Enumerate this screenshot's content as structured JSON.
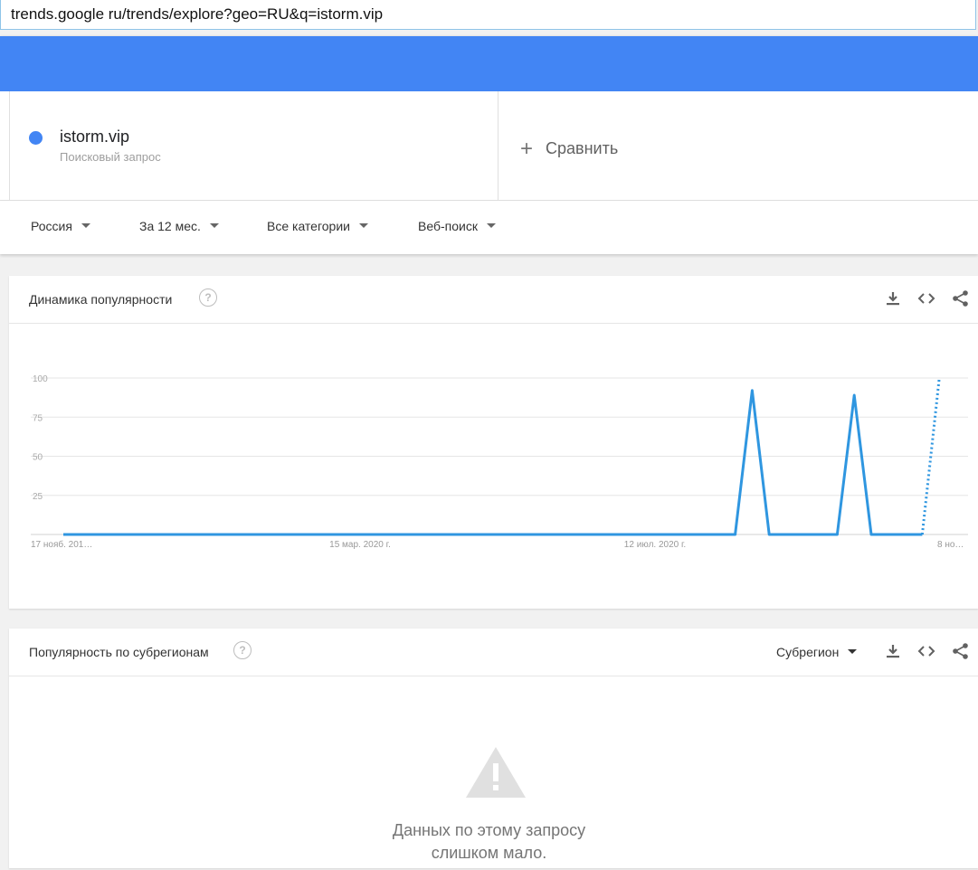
{
  "browser": {
    "url": "trends.google ru/trends/explore?geo=RU&q=istorm.vip"
  },
  "term": {
    "name": "istorm.vip",
    "type": "Поисковый запрос",
    "color": "#4285f4"
  },
  "compare": {
    "label": "Сравнить"
  },
  "filters": {
    "region": "Россия",
    "period": "За 12 мес.",
    "category": "Все категории",
    "search_type": "Веб-поиск"
  },
  "interest_over_time": {
    "title": "Динамика популярности",
    "icons": [
      "help-icon",
      "download-icon",
      "embed-icon",
      "share-icon"
    ]
  },
  "chart_data": {
    "type": "line",
    "title": "",
    "xlabel": "",
    "ylabel": "",
    "ylim": [
      0,
      100
    ],
    "yticks": [
      "100",
      "75",
      "50",
      "25"
    ],
    "xticks": [
      "17 нояб. 201…",
      "15 мар. 2020 г.",
      "12 июл. 2020 г.",
      "8 но…"
    ],
    "grid": true,
    "line_color": "#2f96e0",
    "series": [
      {
        "values": [
          0,
          0,
          0,
          0,
          0,
          0,
          0,
          0,
          0,
          0,
          0,
          0,
          0,
          0,
          0,
          0,
          0,
          0,
          0,
          0,
          0,
          0,
          0,
          0,
          0,
          0,
          0,
          0,
          0,
          0,
          0,
          0,
          0,
          0,
          0,
          0,
          0,
          0,
          0,
          0,
          0,
          0,
          0,
          0,
          0,
          0,
          0,
          0,
          0,
          0,
          0,
          0,
          0,
          0,
          0,
          0,
          0,
          0,
          0,
          0,
          0,
          0,
          0,
          0,
          0,
          0,
          0,
          0,
          0,
          0,
          0,
          0,
          0,
          0,
          0,
          0,
          0,
          0,
          0,
          0,
          0,
          0,
          0,
          0,
          0,
          0,
          0,
          0,
          0,
          0,
          0,
          0,
          0,
          0,
          0,
          0,
          0,
          0,
          0,
          0,
          0,
          0,
          0,
          0,
          0,
          0,
          0,
          0,
          0,
          0,
          0,
          0,
          0,
          0,
          0,
          0,
          0,
          0,
          0,
          0,
          0,
          0,
          0,
          0,
          0,
          0,
          0,
          0,
          0,
          0,
          0,
          0,
          0,
          0,
          0,
          0,
          0,
          0,
          0,
          0,
          0,
          0,
          0,
          0,
          0,
          0,
          0,
          0,
          0,
          0,
          0,
          0,
          0,
          0,
          0,
          0,
          0,
          0,
          0,
          0,
          0,
          0,
          0,
          0,
          0,
          0,
          0,
          0,
          0,
          0,
          0,
          0,
          0,
          0,
          0,
          0,
          0,
          0,
          0,
          0,
          0,
          0,
          0,
          0,
          0,
          0,
          0,
          0,
          0,
          0,
          0,
          0,
          0,
          0,
          0,
          0,
          0,
          0,
          0,
          0,
          0,
          0,
          0,
          0,
          0,
          0,
          0,
          0,
          0,
          0,
          0,
          0,
          0,
          0,
          0,
          0,
          0,
          0,
          0,
          0,
          0,
          0,
          0,
          0,
          0,
          0,
          0,
          0,
          0,
          0,
          0,
          0,
          0,
          0,
          0,
          0,
          0,
          0,
          0,
          0,
          0,
          0,
          0,
          0,
          0,
          0,
          0,
          0,
          0,
          0,
          0,
          0,
          0,
          0,
          0,
          0,
          0,
          0,
          0,
          0,
          0,
          0,
          0,
          0,
          0,
          0,
          0,
          0,
          0,
          0,
          0,
          0,
          0,
          0,
          0,
          0,
          0,
          0,
          0,
          0,
          0,
          0,
          0,
          0,
          0,
          0,
          0,
          0,
          0,
          0,
          0,
          0,
          0,
          0,
          0,
          0,
          0,
          0,
          0,
          0,
          0,
          0,
          0,
          0,
          0,
          0,
          0,
          0,
          0,
          0,
          0,
          0,
          0,
          0,
          0,
          0,
          0,
          0,
          0,
          0,
          0,
          0,
          0,
          0,
          0,
          0,
          0,
          0,
          0,
          0,
          0,
          0,
          0,
          0,
          0,
          0,
          0,
          0,
          0,
          0,
          0,
          0,
          0,
          0,
          0,
          0,
          0,
          0,
          0,
          0,
          0,
          0,
          0,
          0,
          0,
          0,
          0,
          0,
          0,
          0,
          0,
          0,
          0,
          0,
          0,
          0,
          0
        ]
      }
    ],
    "points": [
      {
        "t": 0.0,
        "v": 0
      },
      {
        "t": 0.79,
        "v": 0
      },
      {
        "t": 0.81,
        "v": 92
      },
      {
        "t": 0.83,
        "v": 0
      },
      {
        "t": 0.91,
        "v": 0
      },
      {
        "t": 0.93,
        "v": 89
      },
      {
        "t": 0.95,
        "v": 0
      },
      {
        "t": 1.01,
        "v": 0
      }
    ],
    "partial_points": [
      {
        "t": 1.01,
        "v": 0
      },
      {
        "t": 1.03,
        "v": 100
      }
    ]
  },
  "interest_by_region": {
    "title": "Популярность по субрегионам",
    "resolution": "Субрегион",
    "no_data_line1": "Данных по этому запросу",
    "no_data_line2": "слишком мало."
  }
}
